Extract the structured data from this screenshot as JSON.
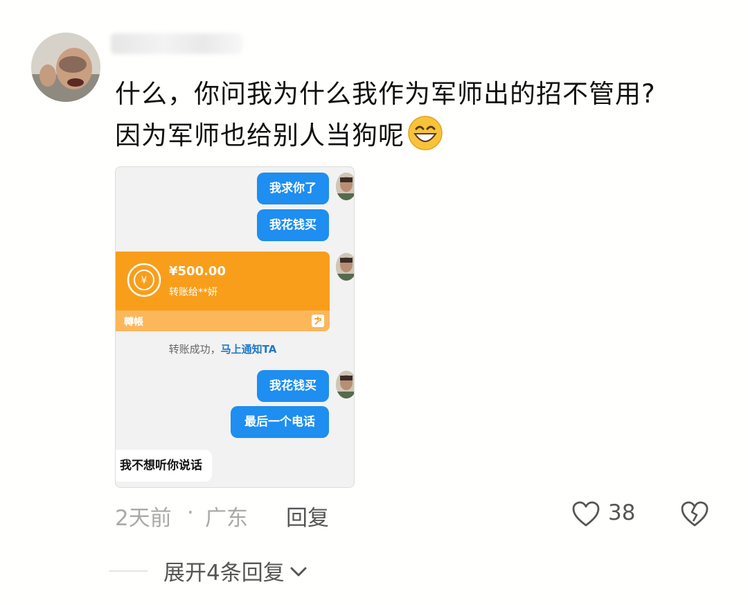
{
  "comment": {
    "line1": "什么，你问我为什么我作为军师出的招不管用?",
    "line2": "因为军师也给别人当狗呢",
    "emoji": "grinning-face-icon"
  },
  "screenshot": {
    "bubble1": "我求你了",
    "bubble2": "我花钱买",
    "transfer_amount": "¥500.00",
    "transfer_to": "转账给**妍",
    "transfer_label": "轉帳",
    "status_text": "转账成功，",
    "status_link": "马上通知TA",
    "bubble3": "我花钱买",
    "bubble4": "最后一个电话",
    "reply_text": "我不想听你说话"
  },
  "footer": {
    "time": "2天前",
    "separator": "·",
    "location": "广东",
    "reply": "回复",
    "likes": "38",
    "expand": "展开4条回复"
  },
  "colors": {
    "bubble_blue": "#1e8ef0",
    "transfer_orange": "#f99e1b",
    "link_blue": "#1f78c6"
  }
}
